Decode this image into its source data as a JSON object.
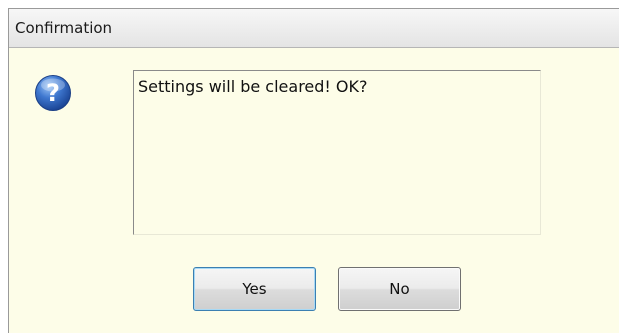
{
  "dialog": {
    "title": "Confirmation",
    "icon": "question-icon",
    "message": "Settings will be cleared! OK?",
    "buttons": {
      "yes_label": "Yes",
      "no_label": "No"
    },
    "colors": {
      "background": "#fdfde8",
      "icon_blue": "#2b5fb3",
      "default_button_border": "#3c7fb1"
    }
  }
}
